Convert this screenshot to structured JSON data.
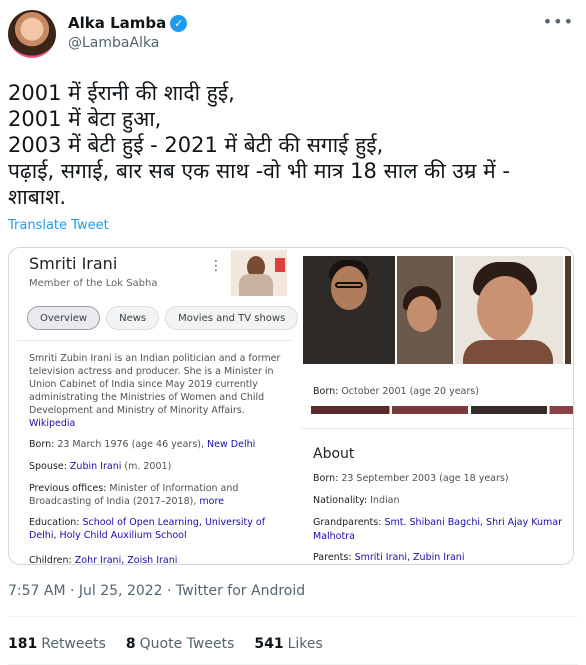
{
  "author": {
    "display_name": "Alka Lamba",
    "handle": "@LambaAlka",
    "verified_glyph": "✓"
  },
  "tweet": {
    "lines": [
      "2001 में ईरानी की शादी हुई,",
      "2001 में बेटा हुआ,",
      "2003 में बेटी हुई - 2021 में बेटी की सगाई हुई,",
      "पढ़ाई, सगाई, बार सब एक साथ -वो भी मात्र 18 साल की उम्र में -",
      "शाबाश."
    ],
    "translate_label": "Translate Tweet",
    "timestamp": "7:57 AM · Jul 25, 2022 · Twitter for Android"
  },
  "panel_left": {
    "title": "Smriti Irani",
    "subtitle": "Member of the Lok Sabha",
    "tabs": [
      "Overview",
      "News",
      "Movies and TV shows"
    ],
    "description": "Smriti Zubin Irani is an Indian politician and a former television actress and producer. She is a Minister in Union Cabinet of India since May 2019 currently administrating the Ministries of Women and Child Development and Ministry of Minority Affairs.",
    "description_link": "Wikipedia",
    "born_label": "Born:",
    "born_value": "23 March 1976 (age 46 years),",
    "born_link": "New Delhi",
    "spouse_label": "Spouse:",
    "spouse_link": "Zubin Irani",
    "spouse_extra": "(m. 2001)",
    "offices_label": "Previous offices:",
    "offices_value": "Minister of Information and Broadcasting of India (2017–2018),",
    "offices_link": "more",
    "education_label": "Education:",
    "education_link": "School of Open Learning, University of Delhi, Holy Child Auxilium School",
    "children_label": "Children:",
    "children_link": "Zohr Irani, Zoish Irani"
  },
  "panel_right": {
    "born_label": "Born:",
    "born_value": "October 2001 (age 20 years)",
    "about_title": "About",
    "born2_label": "Born:",
    "born2_value": "23 September 2003 (age 18 years)",
    "nationality_label": "Nationality:",
    "nationality_value": "Indian",
    "grandparents_label": "Grandparents:",
    "grandparents_link": "Smt. Shibani Bagchi, Shri Ajay Kumar Malhotra",
    "parents_label": "Parents:",
    "parents_link": "Smriti Irani, Zubin Irani"
  },
  "stats": [
    {
      "count": "181",
      "label": "Retweets"
    },
    {
      "count": "8",
      "label": "Quote Tweets"
    },
    {
      "count": "541",
      "label": "Likes"
    }
  ]
}
